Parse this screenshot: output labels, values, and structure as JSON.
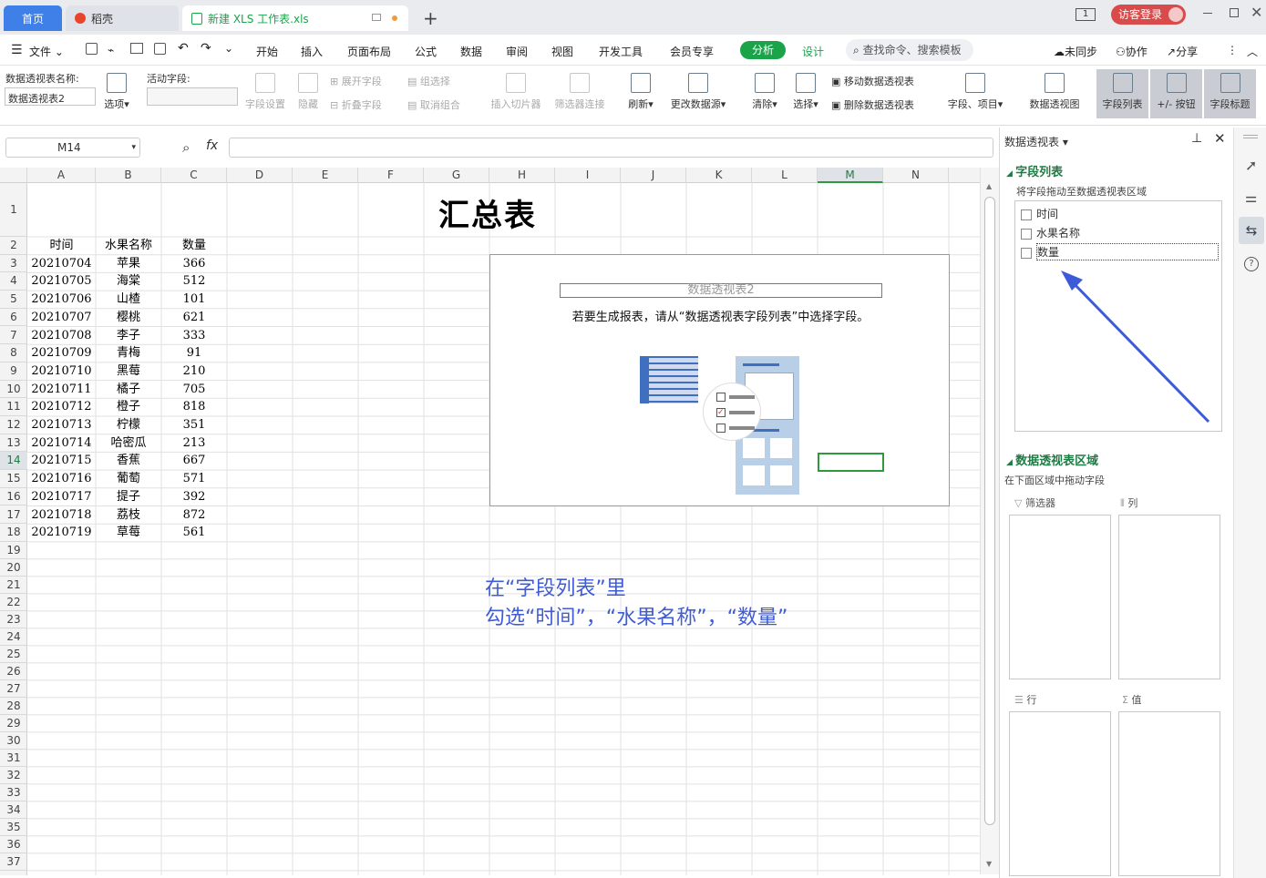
{
  "tabs": {
    "home": "首页",
    "docer": "稻壳",
    "file": "新建 XLS 工作表.xls"
  },
  "header": {
    "page_count": "1",
    "login": "访客登录"
  },
  "menu": {
    "file": "文件",
    "items": [
      "开始",
      "插入",
      "页面布局",
      "公式",
      "数据",
      "审阅",
      "视图",
      "开发工具",
      "会员专享",
      "分析",
      "设计"
    ],
    "search_placeholder": "查找命令、搜索模板",
    "sync": "未同步",
    "collab": "协作",
    "share": "分享"
  },
  "ribbon": {
    "pivot_name_label": "数据透视表名称:",
    "pivot_name": "数据透视表2",
    "options": "选项",
    "active_field_label": "活动字段:",
    "field_settings": "字段设置",
    "hide": "隐藏",
    "expand": "展开字段",
    "collapse": "折叠字段",
    "group_select": "组选择",
    "ungroup": "取消组合",
    "insert_slicer": "插入切片器",
    "filter_conn": "筛选器连接",
    "refresh": "刷新",
    "change_source": "更改数据源",
    "clear": "清除",
    "select": "选择",
    "move_pivot": "移动数据透视表",
    "delete_pivot": "删除数据透视表",
    "fields_items": "字段、项目",
    "pivot_chart": "数据透视图",
    "field_list": "字段列表",
    "buttons": "+/- 按钮",
    "field_headers": "字段标题"
  },
  "formula": {
    "cell_ref": "M14",
    "fx": "fx",
    "value": ""
  },
  "sheet": {
    "columns": [
      "A",
      "B",
      "C",
      "D",
      "E",
      "F",
      "G",
      "H",
      "I",
      "J",
      "K",
      "L",
      "M",
      "N"
    ],
    "rows": [
      "1",
      "2",
      "3",
      "4",
      "5",
      "6",
      "7",
      "8",
      "9",
      "10",
      "11",
      "12",
      "13",
      "14",
      "15",
      "16",
      "17",
      "18",
      "19",
      "20",
      "21",
      "22",
      "23",
      "24",
      "25",
      "26",
      "27",
      "28",
      "29",
      "30",
      "31",
      "32",
      "33",
      "34",
      "35",
      "36",
      "37"
    ],
    "title": "汇总表",
    "headers": [
      "时间",
      "水果名称",
      "数量"
    ],
    "data": [
      [
        "20210704",
        "苹果",
        "366"
      ],
      [
        "20210705",
        "海棠",
        "512"
      ],
      [
        "20210706",
        "山楂",
        "101"
      ],
      [
        "20210707",
        "樱桃",
        "621"
      ],
      [
        "20210708",
        "李子",
        "333"
      ],
      [
        "20210709",
        "青梅",
        "91"
      ],
      [
        "20210710",
        "黑莓",
        "210"
      ],
      [
        "20210711",
        "橘子",
        "705"
      ],
      [
        "20210712",
        "橙子",
        "818"
      ],
      [
        "20210713",
        "柠檬",
        "351"
      ],
      [
        "20210714",
        "哈密瓜",
        "213"
      ],
      [
        "20210715",
        "香蕉",
        "667"
      ],
      [
        "20210716",
        "葡萄",
        "571"
      ],
      [
        "20210717",
        "提子",
        "392"
      ],
      [
        "20210718",
        "荔枝",
        "872"
      ],
      [
        "20210719",
        "草莓",
        "561"
      ]
    ]
  },
  "pivot": {
    "name": "数据透视表2",
    "hint": "若要生成报表，请从“数据透视表字段列表”中选择字段。"
  },
  "annotation": {
    "line1": "在“字段列表”里",
    "line2": "勾选“时间”，“水果名称”，“数量”"
  },
  "panel": {
    "title": "数据透视表",
    "field_list_title": "字段列表",
    "field_list_hint": "将字段拖动至数据透视表区域",
    "fields": [
      "时间",
      "水果名称",
      "数量"
    ],
    "area_title": "数据透视表区域",
    "area_hint": "在下面区域中拖动字段",
    "filter": "筛选器",
    "columns": "列",
    "rows": "行",
    "values": "值"
  },
  "colors": {
    "accent": "#3f7fe8",
    "analysis": "#1ba34a",
    "annotation": "#3f5bd6",
    "arrow": "#3d5bd8"
  }
}
